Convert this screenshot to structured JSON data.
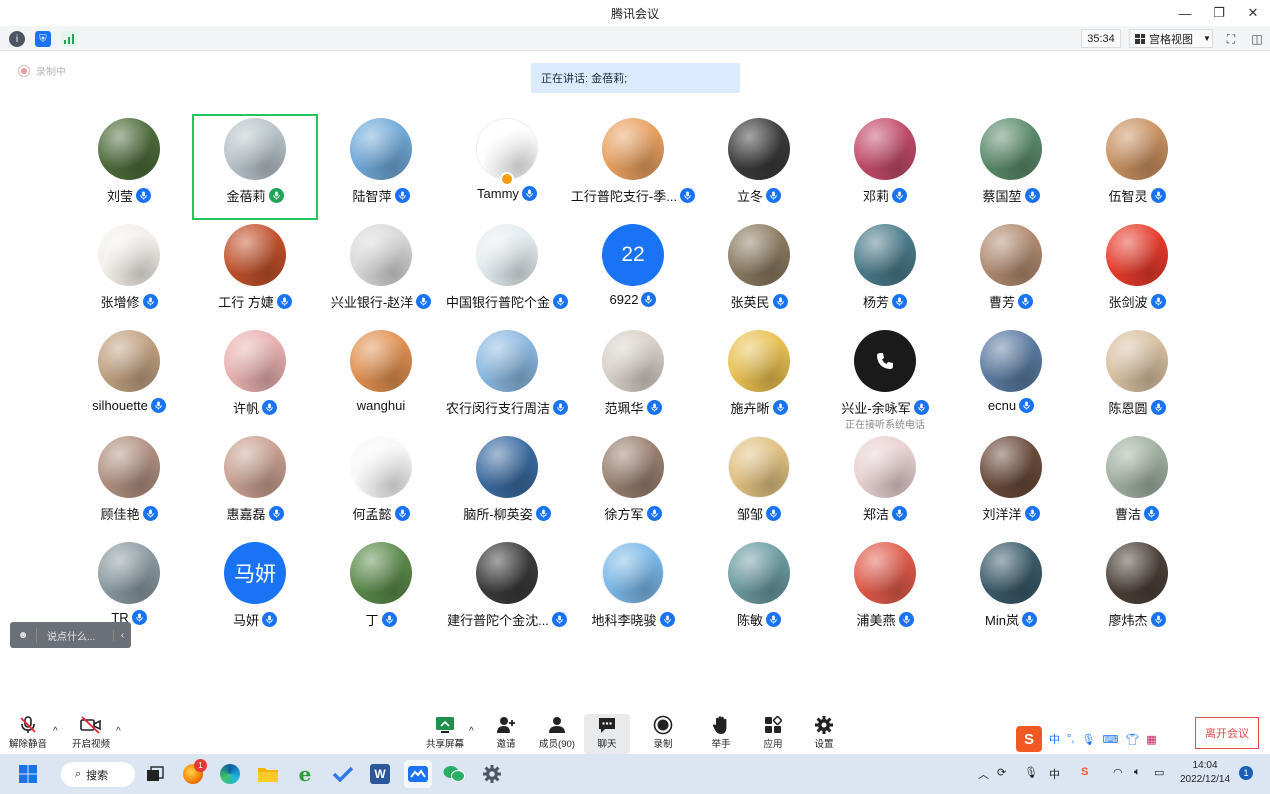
{
  "window": {
    "title": "腾讯会议"
  },
  "infobar": {
    "timer": "35:34",
    "view_mode": "宫格视图"
  },
  "recording": {
    "label": "录制中"
  },
  "speaking": {
    "text": "正在讲话: 金蓓莉;"
  },
  "participants": [
    {
      "name": "刘莹",
      "avatar": "photo",
      "color": "#4d6b3a",
      "mic": "blue"
    },
    {
      "name": "金蓓莉",
      "avatar": "photo",
      "color": "#b8c4c9",
      "mic": "green",
      "active": true
    },
    {
      "name": "陆智萍",
      "avatar": "photo",
      "color": "#6fa8d8",
      "mic": "blue"
    },
    {
      "name": "Tammy",
      "avatar": "cartoon",
      "color": "#ffffff",
      "mic": "blue",
      "role": true
    },
    {
      "name": "工行普陀支行-季...",
      "avatar": "photo",
      "color": "#e8a060",
      "mic": "blue"
    },
    {
      "name": "立冬",
      "avatar": "photo",
      "color": "#3a3a3a",
      "mic": "blue"
    },
    {
      "name": "邓莉",
      "avatar": "photo",
      "color": "#c24a6a",
      "mic": "blue"
    },
    {
      "name": "蔡国堃",
      "avatar": "photo",
      "color": "#5a8a6a",
      "mic": "blue"
    },
    {
      "name": "伍智灵",
      "avatar": "photo",
      "color": "#c89060",
      "mic": "blue"
    },
    {
      "name": "张增修",
      "avatar": "logo",
      "color": "#f4f0ea",
      "mic": "blue"
    },
    {
      "name": "工行 方婕",
      "avatar": "photo",
      "color": "#c0502a",
      "mic": "blue"
    },
    {
      "name": "兴业银行-赵洋",
      "avatar": "photo",
      "color": "#d8d8d8",
      "mic": "blue"
    },
    {
      "name": "中国银行普陀个金",
      "avatar": "photo",
      "color": "#e4ecf0",
      "mic": "blue"
    },
    {
      "name": "6922",
      "avatar": "text",
      "text": "22",
      "color": "#1a73f5",
      "mic": "blue"
    },
    {
      "name": "张英民",
      "avatar": "photo",
      "color": "#8a7a60",
      "mic": "blue"
    },
    {
      "name": "杨芳",
      "avatar": "photo",
      "color": "#4a7a8a",
      "mic": "blue"
    },
    {
      "name": "曹芳",
      "avatar": "photo",
      "color": "#b08a70",
      "mic": "blue"
    },
    {
      "name": "张剑波",
      "avatar": "logo",
      "color": "#e63a2a",
      "mic": "blue"
    },
    {
      "name": "silhouette",
      "avatar": "photo",
      "color": "#c0a080",
      "mic": "blue"
    },
    {
      "name": "许帆",
      "avatar": "photo",
      "color": "#e8b0b0",
      "mic": "blue"
    },
    {
      "name": "wanghui",
      "avatar": "photo",
      "color": "#e09050",
      "mic": "none"
    },
    {
      "name": "农行闵行支行周洁",
      "avatar": "photo",
      "color": "#8ab8e0",
      "mic": "blue"
    },
    {
      "name": "范珮华",
      "avatar": "photo",
      "color": "#d8d0c8",
      "mic": "blue"
    },
    {
      "name": "施卉晰",
      "avatar": "photo",
      "color": "#e8c050",
      "mic": "blue"
    },
    {
      "name": "兴业-余咏军",
      "avatar": "phone",
      "color": "#1a1a1a",
      "mic": "blue",
      "sub": "正在接听系统电话"
    },
    {
      "name": "ecnu",
      "avatar": "photo",
      "color": "#5a7aa0",
      "mic": "blue"
    },
    {
      "name": "陈恩圆",
      "avatar": "photo",
      "color": "#d8c0a0",
      "mic": "blue"
    },
    {
      "name": "顾佳艳",
      "avatar": "photo",
      "color": "#b09080",
      "mic": "blue"
    },
    {
      "name": "惠嘉磊",
      "avatar": "photo",
      "color": "#c8a090",
      "mic": "blue"
    },
    {
      "name": "何孟懿",
      "avatar": "logo",
      "color": "#f8f8f8",
      "mic": "blue"
    },
    {
      "name": "脑所-柳英姿",
      "avatar": "photo",
      "color": "#3a6aa0",
      "mic": "blue"
    },
    {
      "name": "徐方军",
      "avatar": "photo",
      "color": "#9a8070",
      "mic": "blue"
    },
    {
      "name": "邹邹",
      "avatar": "cartoon",
      "color": "#e0c080",
      "mic": "blue"
    },
    {
      "name": "郑洁",
      "avatar": "photo",
      "color": "#e8d0d0",
      "mic": "blue"
    },
    {
      "name": "刘洋洋",
      "avatar": "photo",
      "color": "#6a4a3a",
      "mic": "blue"
    },
    {
      "name": "曹洁",
      "avatar": "photo",
      "color": "#a0b0a0",
      "mic": "blue"
    },
    {
      "name": "TR",
      "avatar": "photo",
      "color": "#8a9aa0",
      "mic": "blue"
    },
    {
      "name": "马妍",
      "avatar": "text",
      "text": "马妍",
      "color": "#1a73f5",
      "mic": "blue"
    },
    {
      "name": "丁",
      "avatar": "photo",
      "color": "#5a8a4a",
      "mic": "blue"
    },
    {
      "name": "建行普陀个金沈...",
      "avatar": "photo",
      "color": "#3a3a3a",
      "mic": "blue"
    },
    {
      "name": "地科李晓骏",
      "avatar": "cartoon",
      "color": "#7ab8e8",
      "mic": "blue"
    },
    {
      "name": "陈敏",
      "avatar": "photo",
      "color": "#6a9aa0",
      "mic": "blue"
    },
    {
      "name": "浦美燕",
      "avatar": "photo",
      "color": "#e05a4a",
      "mic": "blue"
    },
    {
      "name": "Min岚",
      "avatar": "photo",
      "color": "#3a5a6a",
      "mic": "blue"
    },
    {
      "name": "廖炜杰",
      "avatar": "photo",
      "color": "#4a4038",
      "mic": "blue"
    }
  ],
  "chat": {
    "placeholder": "说点什么..."
  },
  "toolbar": {
    "unmute": "解除静音",
    "start_video": "开启视频",
    "share_screen": "共享屏幕",
    "invite": "邀请",
    "members": "成员(90)",
    "chat": "聊天",
    "record": "录制",
    "raise_hand": "举手",
    "apps": "应用",
    "settings": "设置",
    "leave": "离开会议"
  },
  "ime": {
    "lang": "中"
  },
  "taskbar": {
    "search": "搜索",
    "badge_count": "1",
    "tray_lang": "中",
    "time": "14:04",
    "date": "2022/12/14",
    "notifications": "1"
  }
}
